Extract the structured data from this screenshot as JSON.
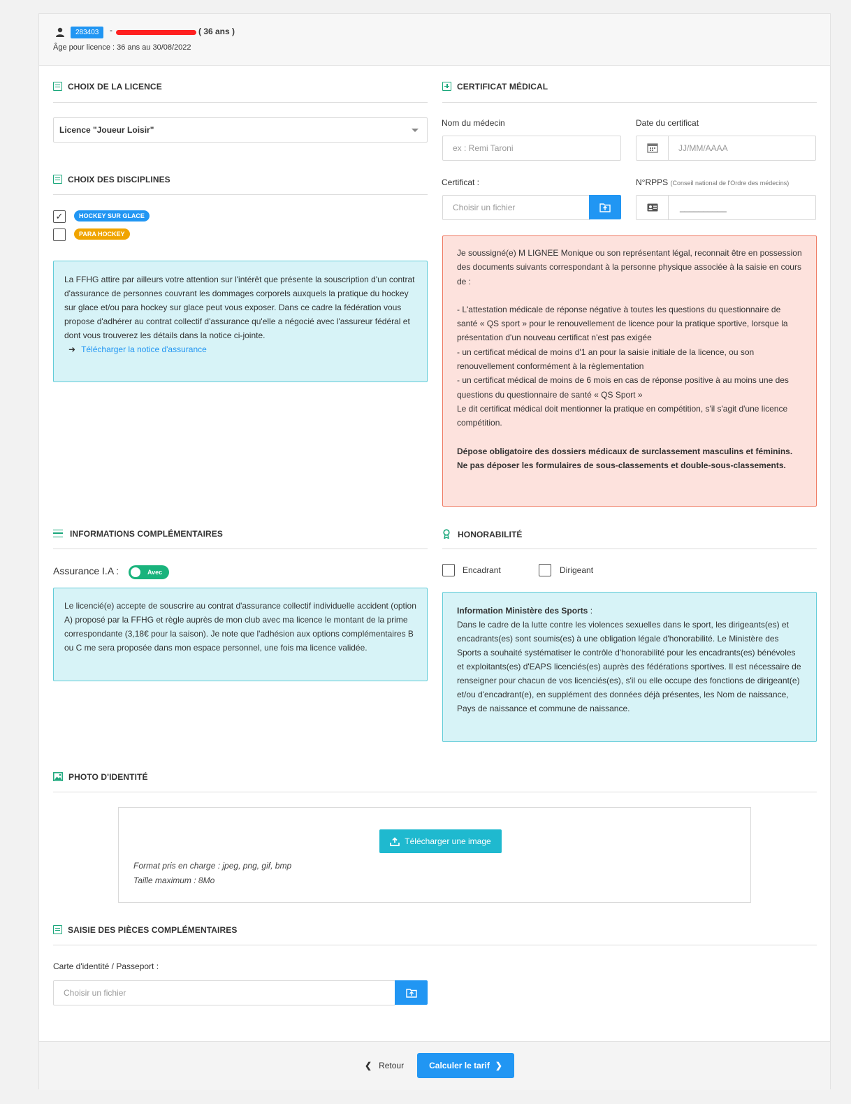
{
  "header": {
    "licence_number": "283403",
    "separator": "-",
    "age_inline": "( 36 ans )",
    "age_licence": "Âge pour licence : 36 ans au 30/08/2022"
  },
  "licence_choice": {
    "title": "CHOIX DE LA LICENCE",
    "selected": "Licence \"Joueur Loisir\""
  },
  "disciplines": {
    "title": "CHOIX DES DISCIPLINES",
    "items": [
      {
        "label": "HOCKEY SUR GLACE",
        "checked": "✓",
        "color": "#2196f3"
      },
      {
        "label": "PARA HOCKEY",
        "checked": "",
        "color": "#f0a400"
      }
    ]
  },
  "insurance_notice": {
    "text": "La FFHG attire par ailleurs votre attention sur l'intérêt que présente la souscription d'un contrat d'assurance de personnes couvrant les dommages corporels auxquels la pratique du hockey sur glace et/ou para hockey sur glace peut vous exposer. Dans ce cadre la fédération vous propose d'adhérer au contrat collectif d'assurance qu'elle a négocié avec l'assureur fédéral et dont vous trouverez les détails dans la notice ci-jointe.",
    "link": "Télécharger la notice d'assurance"
  },
  "medical": {
    "title": "CERTIFICAT MÉDICAL",
    "doctor_label": "Nom du médecin",
    "doctor_placeholder": "ex : Remi Taroni",
    "date_label": "Date du certificat",
    "date_placeholder": "JJ/MM/AAAA",
    "certificate_label": "Certificat :",
    "certificate_placeholder": "Choisir un fichier",
    "rpps_label": "N°RPPS",
    "rpps_hint": "(Conseil national de l'Ordre des médecins)",
    "rpps_value": "__________",
    "declaration_p1": "Je soussigné(e) M LIGNEE Monique ou son représentant légal, reconnait être en possession des documents suivants correspondant à la personne physique associée à la saisie en cours de :",
    "declaration_items": [
      "- L'attestation médicale de réponse négative à toutes les questions du questionnaire de santé « QS sport » pour le renouvellement de licence pour la pratique sportive, lorsque la présentation d'un nouveau certificat n'est pas exigée",
      "- un certificat médical de moins d'1 an pour la saisie initiale de la licence, ou son renouvellement conformément à la règlementation",
      "- un certificat médical de moins de 6 mois en cas de réponse positive à au moins une des questions du questionnaire de santé « QS Sport »",
      "Le dit certificat médical doit mentionner la pratique en compétition, s'il s'agit d'une licence compétition."
    ],
    "declaration_bold": "Dépose obligatoire des dossiers médicaux de surclassement masculins et féminins. Ne pas déposer les formulaires de sous-classements et double-sous-classements."
  },
  "complementary": {
    "title": "INFORMATIONS COMPLÉMENTAIRES",
    "insurance_label": "Assurance I.A :",
    "toggle_label": "Avec",
    "text": "Le licencié(e) accepte de souscrire au contrat d'assurance collectif individuelle accident (option A) proposé par la FFHG et règle auprès de mon club avec ma licence le montant de la prime correspondante (3,18€ pour la saison). Je note que l'adhésion aux options complémentaires B ou C me sera proposée dans mon espace personnel, une fois ma licence validée."
  },
  "honorability": {
    "title": "HONORABILITÉ",
    "options": [
      "Encadrant",
      "Dirigeant"
    ],
    "info_title": "Information Ministère des Sports",
    "info_colon": " :",
    "info_text": "Dans le cadre de la lutte contre les violences sexuelles dans le sport, les dirigeants(es) et encadrants(es) sont soumis(es) à une obligation légale d'honorabilité. Le Ministère des Sports a souhaité systématiser le contrôle d'honorabilité pour les encadrants(es) bénévoles et exploitants(es) d'EAPS licenciés(es) auprès des fédérations sportives. Il est nécessaire de renseigner pour chacun de vos licenciés(es), s'il ou elle occupe des fonctions de dirigeant(e) et/ou d'encadrant(e), en supplément des données déjà présentes, les Nom de naissance, Pays de naissance et commune de naissance."
  },
  "photo": {
    "title": "PHOTO D'IDENTITÉ",
    "upload_button": "Télécharger une image",
    "formats": "Format pris en charge : jpeg, png, gif, bmp",
    "max_size": "Taille maximum : 8Mo"
  },
  "extra_docs": {
    "title": "SAISIE DES PIÈCES COMPLÉMENTAIRES",
    "id_label": "Carte d'identité / Passeport :",
    "id_placeholder": "Choisir un fichier"
  },
  "footer": {
    "back_label": "Retour",
    "submit_label": "Calculer le tarif"
  },
  "colors": {
    "primary": "#2196f3",
    "accent_green": "#19a77b",
    "info_blue_bg": "#d7f3f7",
    "warning_bg": "#fde2dd",
    "teal_button": "#1fb9cf"
  }
}
